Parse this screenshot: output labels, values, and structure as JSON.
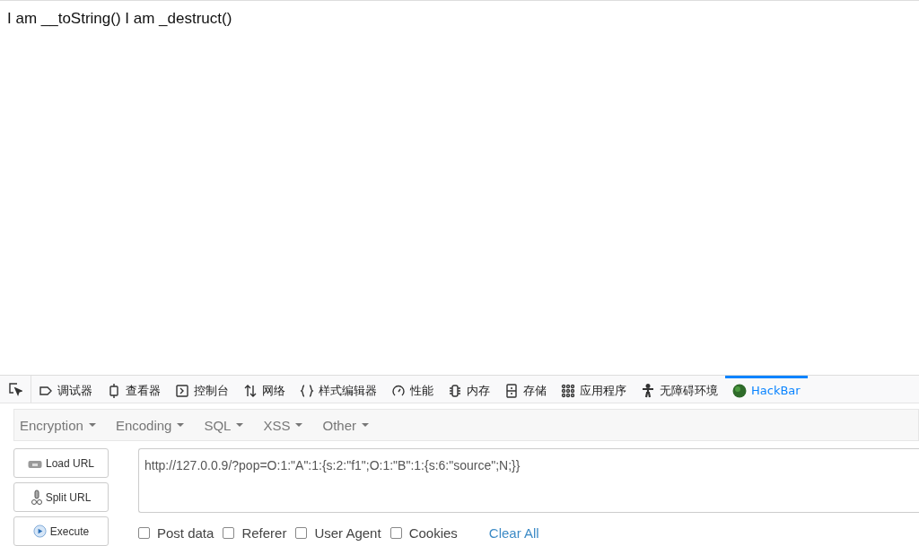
{
  "page": {
    "text": "I am __toString() I am _destruct()"
  },
  "devtools_tabs": [
    {
      "label": "调试器",
      "selected": false
    },
    {
      "label": "查看器",
      "selected": false
    },
    {
      "label": "控制台",
      "selected": false
    },
    {
      "label": "网络",
      "selected": false
    },
    {
      "label": "样式编辑器",
      "selected": false
    },
    {
      "label": "性能",
      "selected": false
    },
    {
      "label": "内存",
      "selected": false
    },
    {
      "label": "存储",
      "selected": false
    },
    {
      "label": "应用程序",
      "selected": false
    },
    {
      "label": "无障碍环境",
      "selected": false
    },
    {
      "label": "HackBar",
      "selected": true
    }
  ],
  "hackbar": {
    "menus": [
      "Encryption",
      "Encoding",
      "SQL",
      "XSS",
      "Other"
    ],
    "buttons": [
      "Load URL",
      "Split URL",
      "Execute"
    ],
    "url": "http://127.0.0.9/?pop=O:1:\"A\":1:{s:2:\"f1\";O:1:\"B\":1:{s:6:\"source\";N;}}",
    "options": [
      {
        "label": "Post data",
        "checked": false
      },
      {
        "label": "Referer",
        "checked": false
      },
      {
        "label": "User Agent",
        "checked": false
      },
      {
        "label": "Cookies",
        "checked": false
      }
    ],
    "clear": "Clear All"
  }
}
